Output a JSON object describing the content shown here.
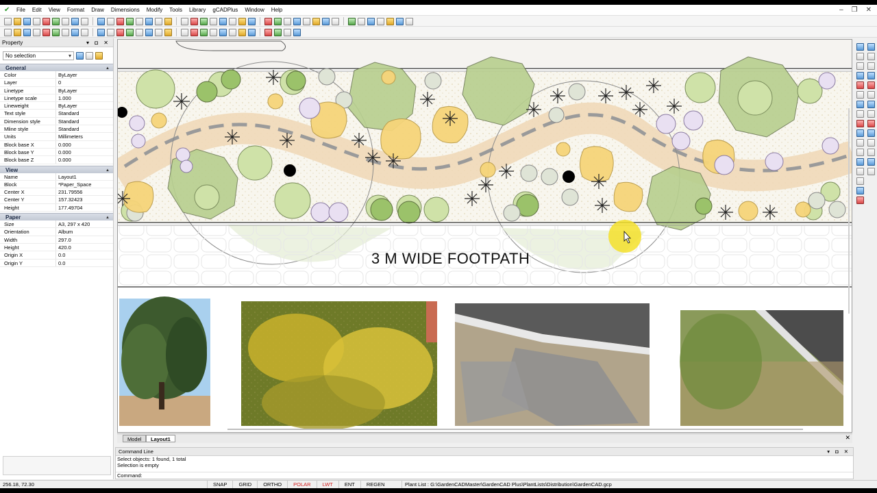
{
  "menubar": {
    "items": [
      "File",
      "Edit",
      "View",
      "Format",
      "Draw",
      "Dimensions",
      "Modify",
      "Tools",
      "Library",
      "gCADPlus",
      "Window",
      "Help"
    ]
  },
  "property_panel": {
    "title": "Property",
    "selection": "No selection",
    "sections": {
      "general": {
        "label": "General",
        "rows": [
          {
            "k": "Color",
            "v": "ByLayer"
          },
          {
            "k": "Layer",
            "v": "0"
          },
          {
            "k": "Linetype",
            "v": "ByLayer"
          },
          {
            "k": "Linetype scale",
            "v": "1.000"
          },
          {
            "k": "Lineweight",
            "v": "ByLayer"
          },
          {
            "k": "Text style",
            "v": "Standard"
          },
          {
            "k": "Dimension style",
            "v": "Standard"
          },
          {
            "k": "Mline style",
            "v": "Standard"
          },
          {
            "k": "Units",
            "v": "Millimeters"
          },
          {
            "k": "Block base X",
            "v": "0.000"
          },
          {
            "k": "Block base Y",
            "v": "0.000"
          },
          {
            "k": "Block base Z",
            "v": "0.000"
          }
        ]
      },
      "view": {
        "label": "View",
        "rows": [
          {
            "k": "Name",
            "v": "Layout1"
          },
          {
            "k": "Block",
            "v": "*Paper_Space"
          },
          {
            "k": "Center X",
            "v": "231.79556"
          },
          {
            "k": "Center Y",
            "v": "157.32423"
          },
          {
            "k": "Height",
            "v": "177.49704"
          }
        ]
      },
      "paper": {
        "label": "Paper",
        "rows": [
          {
            "k": "Size",
            "v": "A3,  297 x 420"
          },
          {
            "k": "Orientation",
            "v": "Album"
          },
          {
            "k": "Width",
            "v": "297.0"
          },
          {
            "k": "Height",
            "v": "420.0"
          },
          {
            "k": "Origin X",
            "v": "0.0"
          },
          {
            "k": "Origin Y",
            "v": "0.0"
          }
        ]
      }
    }
  },
  "drawing": {
    "label": "3 M WIDE FOOTPATH"
  },
  "tabs": {
    "model": "Model",
    "layout": "Layout1"
  },
  "command": {
    "title": "Command Line",
    "lines": [
      "Select objects: 1 found,  1 total",
      "Selection is empty"
    ],
    "prompt": "Command:"
  },
  "status": {
    "coords": "256.18,  72.30",
    "buttons": [
      {
        "label": "SNAP",
        "on": false
      },
      {
        "label": "GRID",
        "on": false
      },
      {
        "label": "ORTHO",
        "on": false
      },
      {
        "label": "POLAR",
        "on": true
      },
      {
        "label": "LWT",
        "on": true
      },
      {
        "label": "ENT",
        "on": false
      },
      {
        "label": "REGEN",
        "on": false
      }
    ],
    "plant_list": "Plant List : G:\\GardenCADMaster\\GardenCAD Plus\\PlantLists\\Distribution\\GardenCAD.gcp"
  },
  "colors": {
    "accent_on": "#d42020",
    "tree_green": "#9bc26a",
    "yellow_shrub": "#f6d57a",
    "lilac_shrub": "#e4d8f0",
    "path_tan": "#efd9b8"
  }
}
